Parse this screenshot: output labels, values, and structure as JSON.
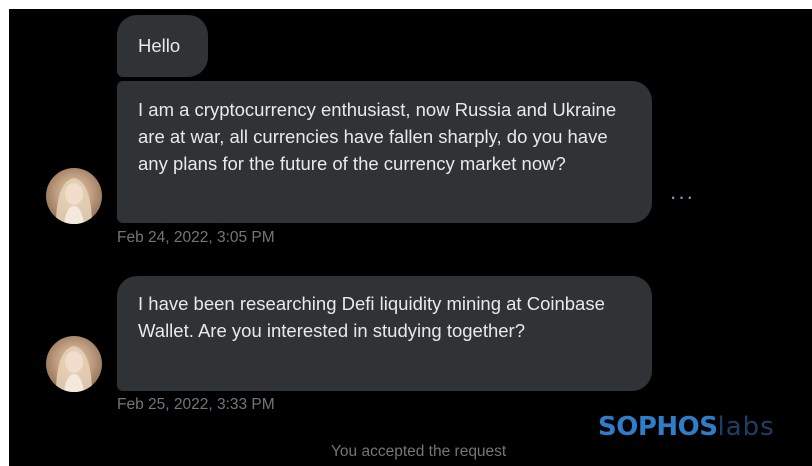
{
  "conversation": {
    "messages": [
      {
        "text": "Hello"
      },
      {
        "text": "I am a cryptocurrency enthusiast, now Russia and Ukraine are at war, all currencies have fallen sharply, do you have any plans for the future of the currency market now?"
      },
      {
        "text": "I have been researching Defi liquidity mining at Coinbase Wallet. Are you interested in studying together?"
      }
    ],
    "timestamps": [
      "Feb 24, 2022, 3:05 PM",
      "Feb 25, 2022, 3:33 PM"
    ],
    "more_label": "···",
    "system_message": "You accepted the request",
    "more_icon": "more-horizontal-icon",
    "avatar_icon": "user-avatar-icon"
  },
  "watermark": {
    "bold": "SOPHOS",
    "light": "labs"
  },
  "colors": {
    "background": "#000000",
    "bubble": "#2f3336",
    "text": "#e7e9ea",
    "muted": "#71767b",
    "brand": "#2f7cc8"
  }
}
